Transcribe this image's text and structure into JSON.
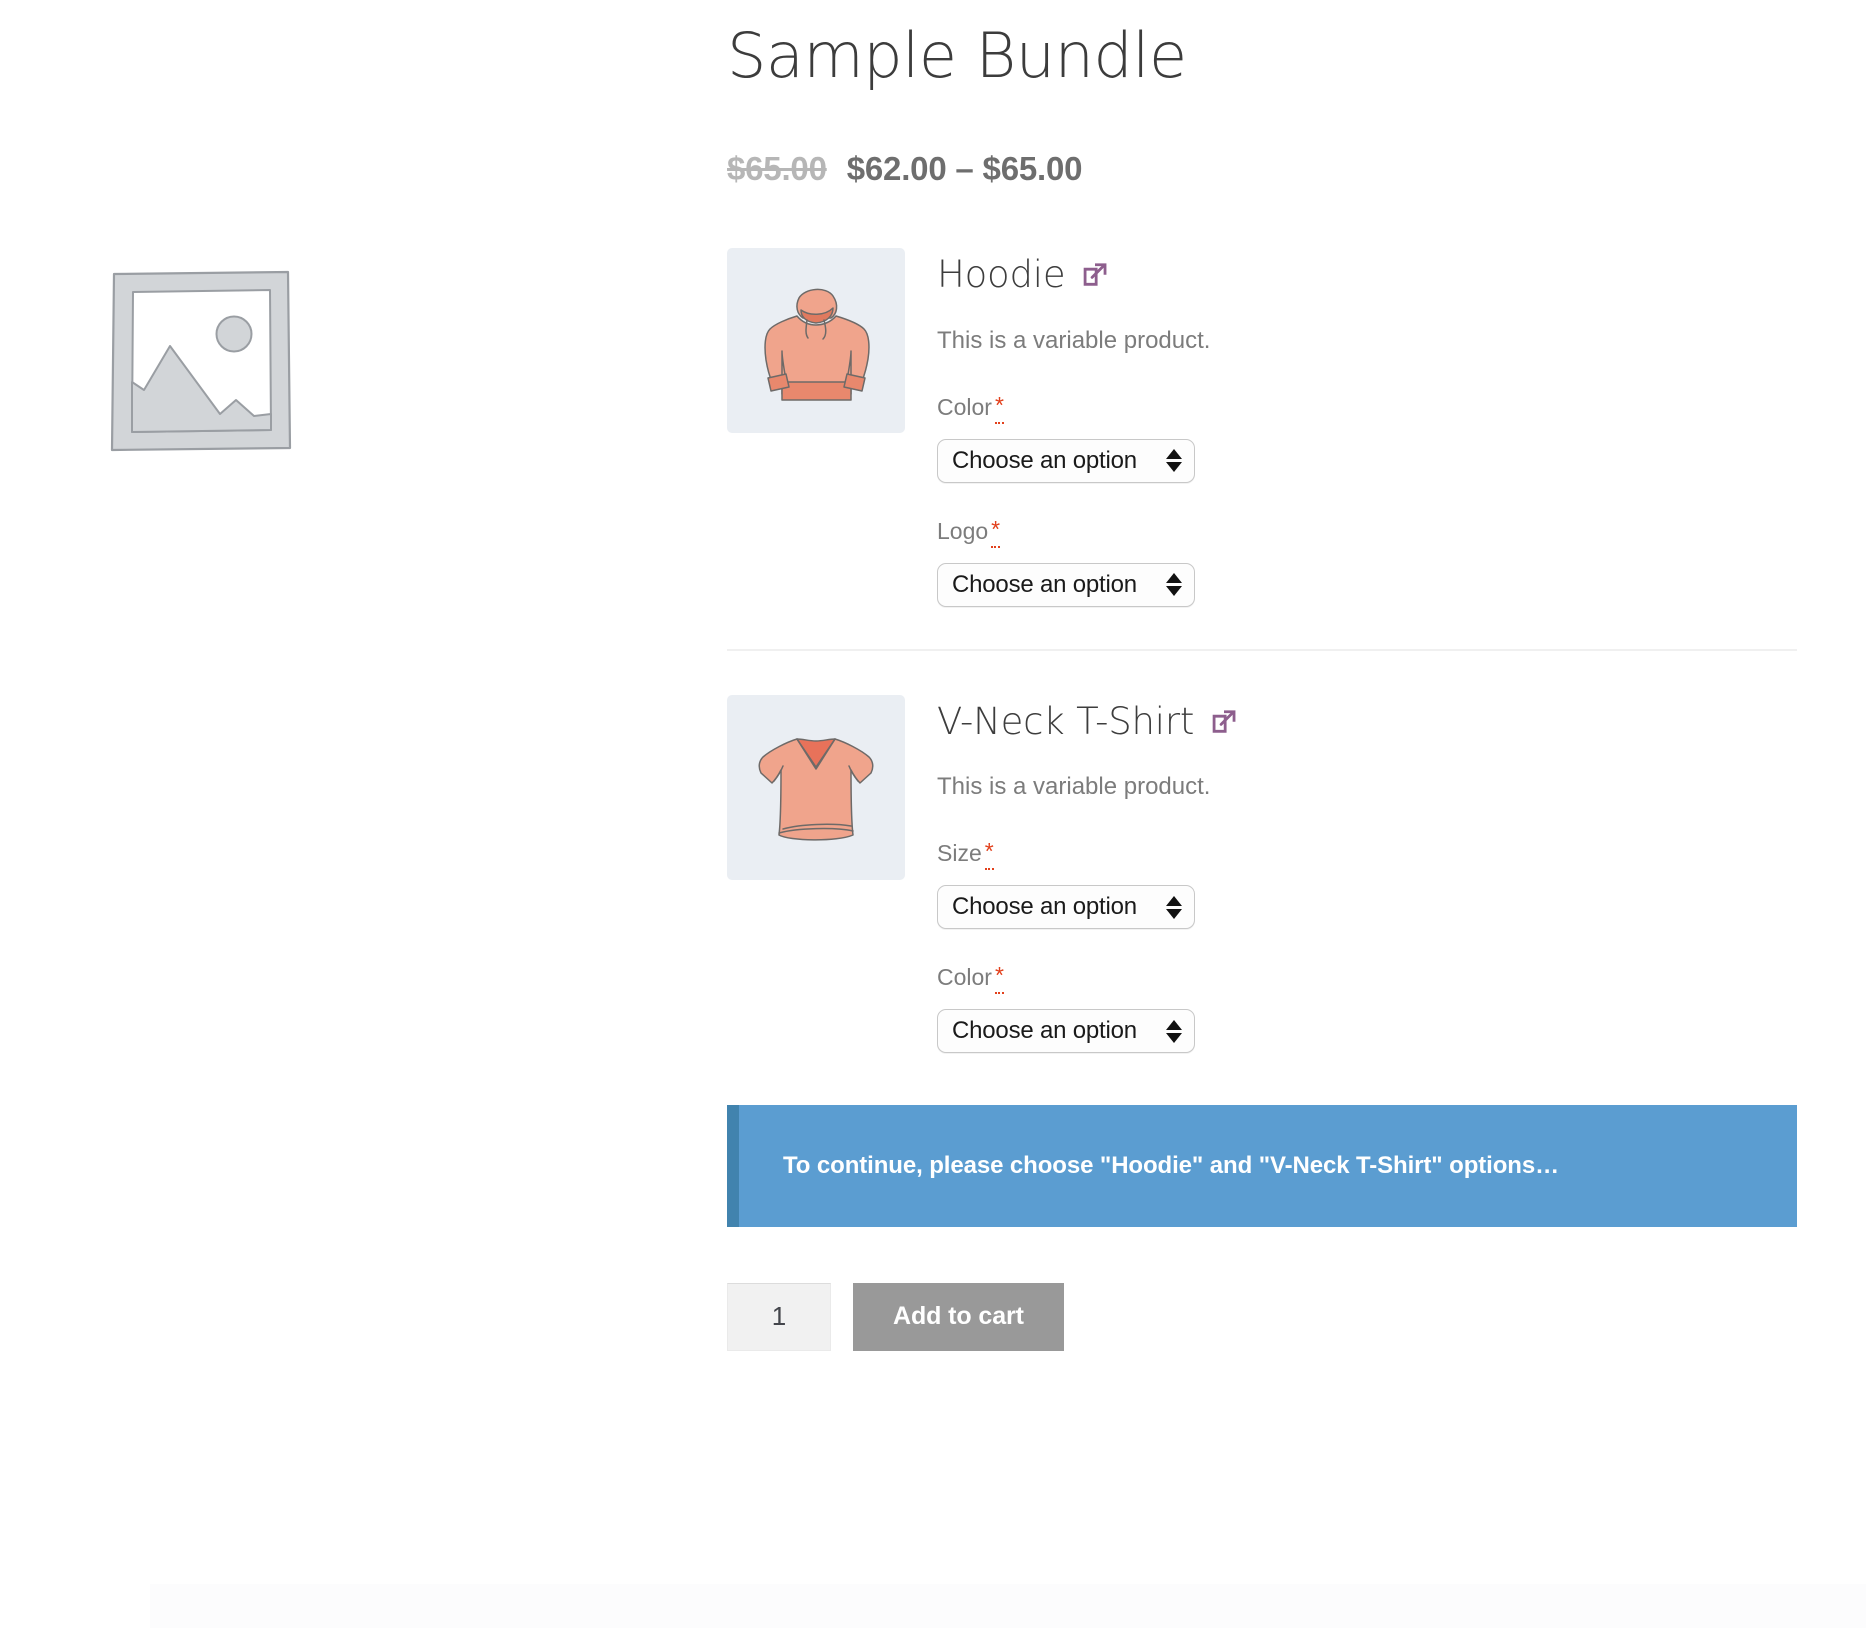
{
  "product": {
    "title": "Sample Bundle",
    "price": {
      "original": "$65.00",
      "current": "$62.00 – $65.00"
    },
    "gallery": {
      "placeholder_alt": "Awaiting product image"
    }
  },
  "bundled_items": [
    {
      "name": "Hoodie",
      "thumbnail": "hoodie-illustration",
      "permalink_icon": "external-link-icon",
      "description": "This is a variable product.",
      "attributes": [
        {
          "label": "Color",
          "required_mark": "*",
          "selected": "Choose an option"
        },
        {
          "label": "Logo",
          "required_mark": "*",
          "selected": "Choose an option"
        }
      ]
    },
    {
      "name": "V-Neck T-Shirt",
      "thumbnail": "tshirt-illustration",
      "permalink_icon": "external-link-icon",
      "description": "This is a variable product.",
      "attributes": [
        {
          "label": "Size",
          "required_mark": "*",
          "selected": "Choose an option"
        },
        {
          "label": "Color",
          "required_mark": "*",
          "selected": "Choose an option"
        }
      ]
    }
  ],
  "notice": {
    "message": "To continue, please choose \"Hoodie\" and \"V-Neck T-Shirt\" options…"
  },
  "cart": {
    "quantity": "1",
    "add_to_cart_label": "Add to cart"
  },
  "colors": {
    "notice_bg": "#5b9dd1",
    "notice_border": "#4183ae",
    "button_bg": "#999999",
    "required_asterisk": "#e2401c",
    "link_icon": "#8d5e8d",
    "thumb_bg": "#eaeef3"
  }
}
